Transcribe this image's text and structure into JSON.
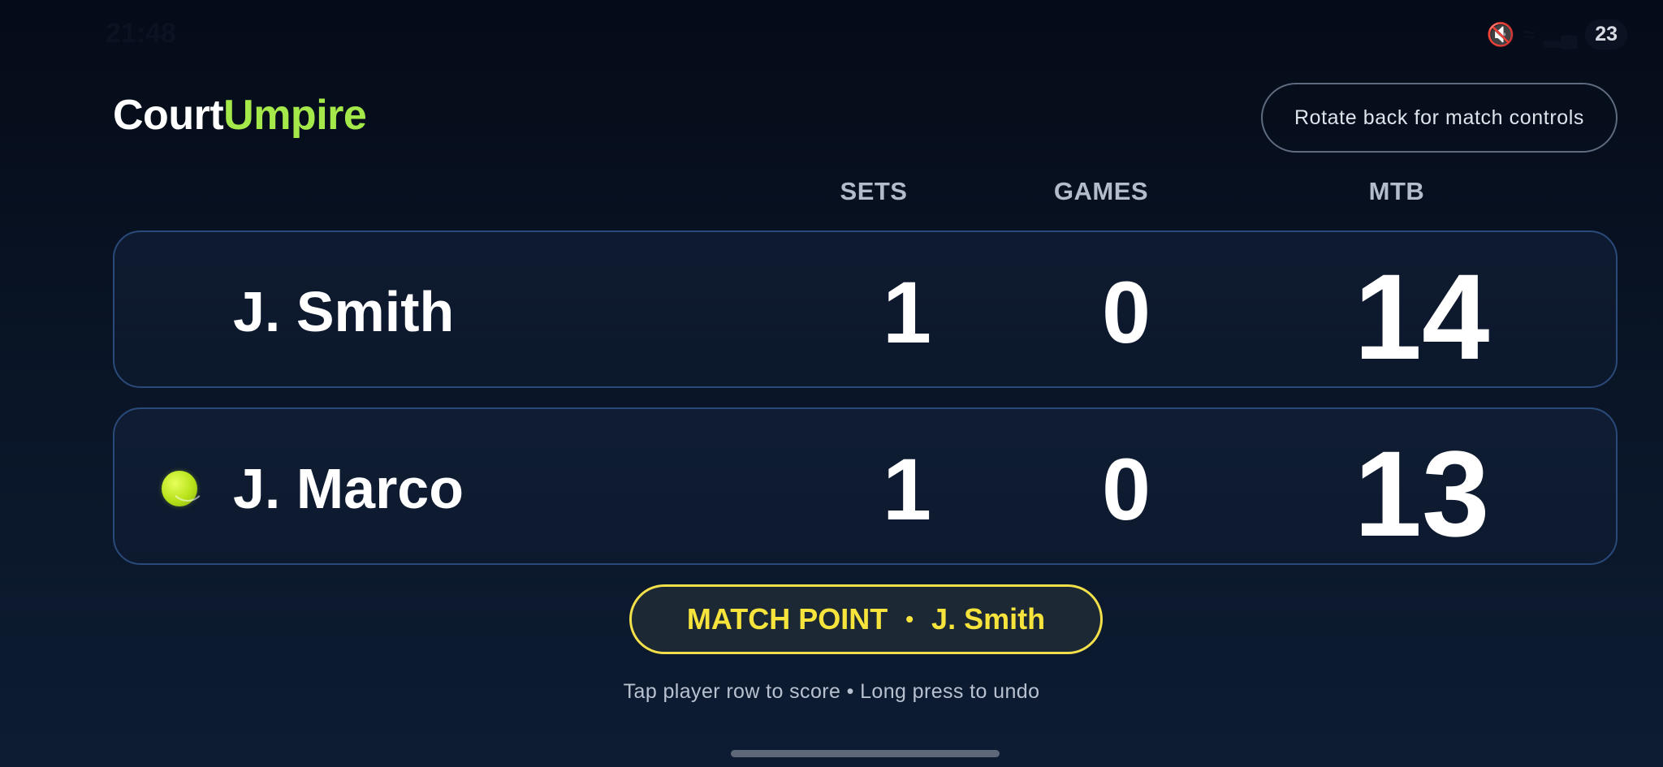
{
  "status_bar": {
    "time": "21:48",
    "battery": "23"
  },
  "brand": {
    "part1": "Court",
    "part2": "Umpire"
  },
  "header": {
    "rotate_button": "Rotate back for match controls"
  },
  "columns": {
    "sets": "SETS",
    "games": "GAMES",
    "mtb": "MTB"
  },
  "players": [
    {
      "name": "J. Smith",
      "sets": "1",
      "games": "0",
      "mtb": "14",
      "serving": false
    },
    {
      "name": "J. Marco",
      "sets": "1",
      "games": "0",
      "mtb": "13",
      "serving": true
    }
  ],
  "match_point": {
    "label": "MATCH POINT",
    "separator": "•",
    "player": "J. Smith"
  },
  "hint": "Tap player row to score • Long press to undo",
  "colors": {
    "accent": "#a4e84a",
    "match_point": "#f6e33c",
    "row_border": "#2a4a7a"
  }
}
